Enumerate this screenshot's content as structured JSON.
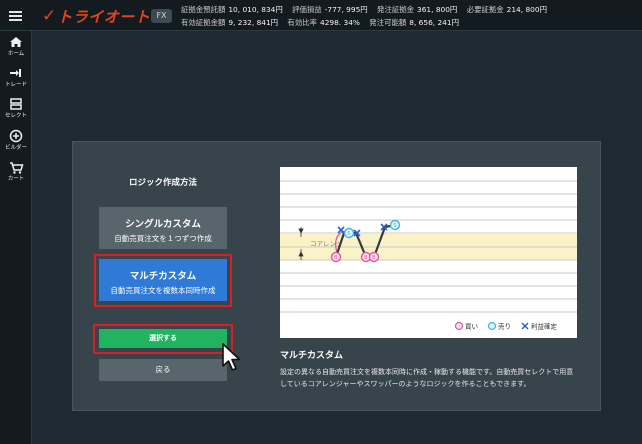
{
  "header": {
    "brand": "トライオート",
    "badge": "FX",
    "stats_row1": [
      {
        "label": "証拠金預託額",
        "value": "10, 010, 834円"
      },
      {
        "label": "評価損益",
        "value": "-777, 995円"
      },
      {
        "label": "発注証拠金",
        "value": "361, 800円"
      },
      {
        "label": "必要証拠金",
        "value": "214, 800円"
      }
    ],
    "stats_row2": [
      {
        "label": "有効証拠金額",
        "value": "9, 232, 841円"
      },
      {
        "label": "有効比率",
        "value": "4298. 34%"
      },
      {
        "label": "発注可能額",
        "value": "8, 656, 241円"
      }
    ]
  },
  "sidebar": {
    "items": [
      {
        "label": "ホーム",
        "icon": "home-icon"
      },
      {
        "label": "トレード",
        "icon": "trade-icon"
      },
      {
        "label": "セレクト",
        "icon": "select-icon"
      },
      {
        "label": "ビルダー",
        "icon": "builder-icon"
      },
      {
        "label": "カート",
        "icon": "cart-icon"
      }
    ]
  },
  "panel": {
    "title": "ロジック作成方法",
    "options": [
      {
        "title": "シングルカスタム",
        "subtitle": "自動売買注文を１つずつ作成"
      },
      {
        "title": "マルチカスタム",
        "subtitle": "自動売買注文を複数本同時作成"
      }
    ],
    "select_label": "選択する",
    "back_label": "戻る"
  },
  "diagram": {
    "range_label": "コアレンジ",
    "legend": {
      "buy": "買い",
      "sell": "売り",
      "take_profit": "利益確定"
    },
    "colors": {
      "buy": "#e0599a",
      "sell": "#3fb3e8",
      "take_profit": "#2a5fd1",
      "band": "#fbf3c8"
    }
  },
  "description": {
    "title": "マルチカスタム",
    "body": "設定の異なる自動売買注文を複数本同時に作成・稼動する機能です。自動売買セレクトで用意しているコアレンジャーやスワッパーのようなロジックを作ることもできます。"
  }
}
